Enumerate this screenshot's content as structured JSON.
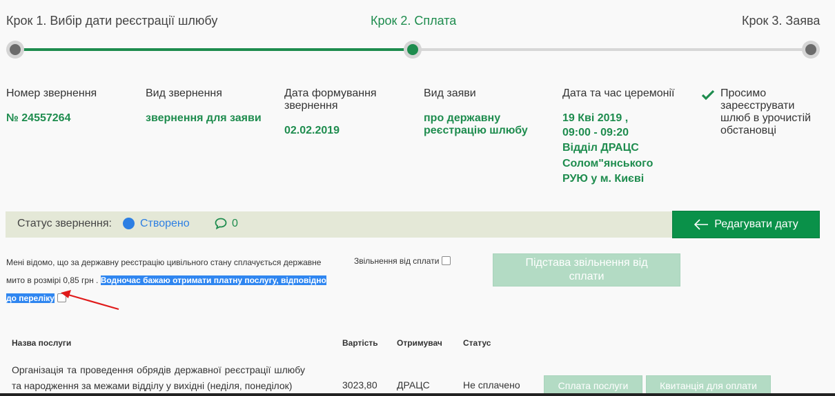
{
  "steps": [
    {
      "label": "Крок 1. Вибір дати реєстрації шлюбу",
      "state": "done"
    },
    {
      "label": "Крок 2. Сплата",
      "state": "active"
    },
    {
      "label": "Крок 3. Заява",
      "state": "pending"
    }
  ],
  "info": {
    "request_number_label": "Номер звернення",
    "request_number_value": "№ 24557264",
    "request_type_label": "Вид звернення",
    "request_type_value": "звернення для заяви",
    "date_formed_label": "Дата формування звернення",
    "date_formed_value": "02.02.2019",
    "application_type_label": "Вид заяви",
    "application_type_value": "про державну реєстрацію шлюбу",
    "ceremony_label": "Дата та час церемонії",
    "ceremony_lines": [
      "19 Кві 2019 ,",
      "09:00 - 09:20",
      "Відділ ДРАЦС",
      "Солом\"янського",
      "РУЮ у м. Києві"
    ],
    "solemn_request": "Просимо зареєструвати шлюб в урочистій обстановці"
  },
  "status": {
    "label": "Статус звернення:",
    "value": "Створено",
    "comments_count": "0",
    "status_color": "#2d7fe3"
  },
  "edit_date_button": "Редагувати дату",
  "consent": {
    "text": "Мені відомо, що за державну реєстрацію цивільного стану сплачується державне мито в розмірі 0,85 грн . ",
    "highlighted": "Водночас бажаю отримати платну послугу, відповідно до переліку"
  },
  "exemption": {
    "label": "Звільнення від сплати",
    "basis_button": "Підстава звільнення від сплати"
  },
  "table": {
    "headers": {
      "name": "Назва послуги",
      "cost": "Вартість",
      "recipient": "Отримувач",
      "status": "Статус"
    },
    "rows": [
      {
        "name": "Організація та проведення обрядів державної реєстрації шлюбу та народження за межами відділу у вихідні (неділя, понеділок)",
        "cost": "3023,80",
        "recipient": "ДРАЦС",
        "status": "Не сплачено",
        "pay_button": "Сплата послуги",
        "receipt_button": "Квитанція для оплати"
      }
    ]
  },
  "colors": {
    "accent": "#1e8c4e",
    "button_green": "#0a9149",
    "disabled_green": "#b3dbc4"
  }
}
